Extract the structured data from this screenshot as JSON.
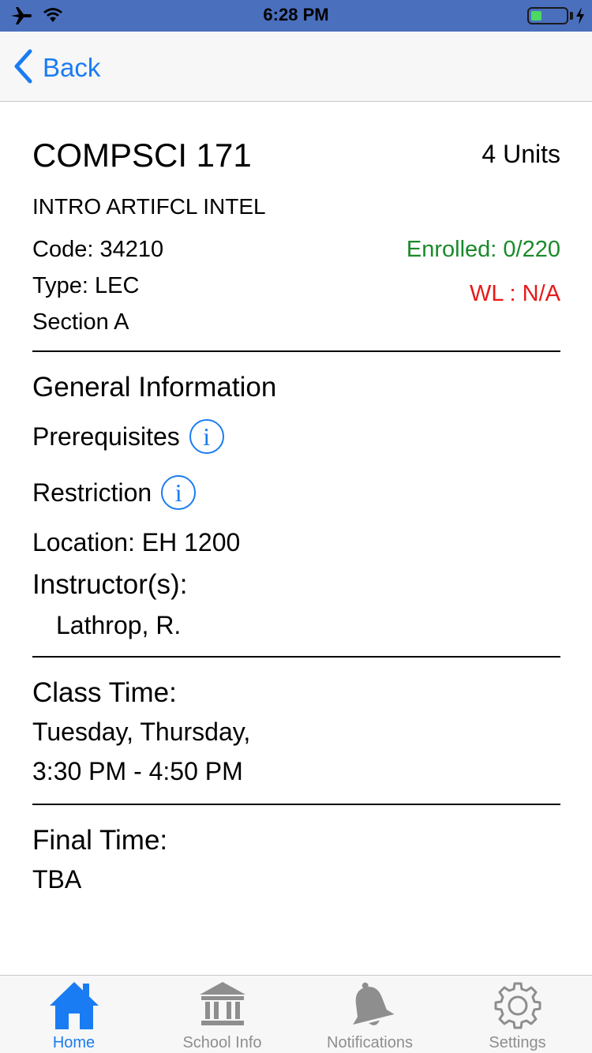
{
  "status_bar": {
    "time": "6:28 PM",
    "icons": [
      "airplane-icon",
      "wifi-icon",
      "battery-icon",
      "charging-icon"
    ],
    "battery_level": 0.3
  },
  "nav": {
    "back_label": "Back",
    "icon": "chevron-left-icon"
  },
  "course": {
    "title": "COMPSCI 171",
    "units": "4 Units",
    "name": "INTRO ARTIFCL INTEL",
    "code": "Code: 34210",
    "type": "Type: LEC",
    "section": "Section A",
    "enrolled": "Enrolled: 0/220",
    "waitlist": "WL : N/A"
  },
  "general": {
    "heading": "General Information",
    "prerequisites_label": "Prerequisites",
    "restriction_label": "Restriction",
    "info_glyph": "i",
    "location": "Location:  EH 1200",
    "instructors_heading": "Instructor(s):",
    "instructor": "Lathrop, R."
  },
  "class_time": {
    "heading": "Class Time:",
    "days": "Tuesday, Thursday,",
    "hours": "3:30 PM - 4:50 PM"
  },
  "final_time": {
    "heading": "Final Time:",
    "value": "TBA"
  },
  "tabs": [
    {
      "label": "Home",
      "icon": "home-icon",
      "active": true
    },
    {
      "label": "School Info",
      "icon": "school-building-icon",
      "active": false
    },
    {
      "label": "Notifications",
      "icon": "bell-icon",
      "active": false
    },
    {
      "label": "Settings",
      "icon": "gear-icon",
      "active": false
    }
  ],
  "colors": {
    "accent": "#1a7cf2",
    "status_bar": "#4a6fbd",
    "enrolled": "#1a8a2a",
    "waitlist": "#e61a1a",
    "inactive_tab": "#8e8e8e"
  }
}
